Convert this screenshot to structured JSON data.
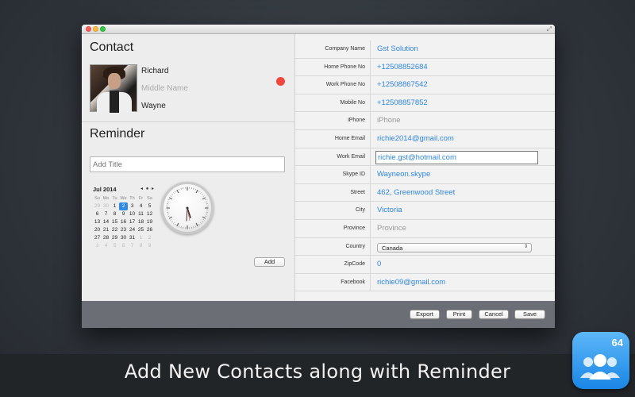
{
  "contact": {
    "title": "Contact",
    "first_name": "Richard",
    "middle_name_placeholder": "Middle Name",
    "last_name": "Wayne"
  },
  "reminder": {
    "title": "Reminder",
    "title_placeholder": "Add Title",
    "add_label": "Add",
    "calendar": {
      "month": "Jul 2014",
      "nav": "◂ ● ▸",
      "weekdays": [
        "Su",
        "Mo",
        "Tu",
        "We",
        "Th",
        "Fr",
        "Sa"
      ],
      "days": [
        [
          "29",
          "30",
          "1",
          "2",
          "3",
          "4",
          "5"
        ],
        [
          "6",
          "7",
          "8",
          "9",
          "10",
          "11",
          "12"
        ],
        [
          "13",
          "14",
          "15",
          "16",
          "17",
          "18",
          "19"
        ],
        [
          "20",
          "21",
          "22",
          "23",
          "24",
          "25",
          "26"
        ],
        [
          "27",
          "28",
          "29",
          "30",
          "31",
          "1",
          "2"
        ],
        [
          "3",
          "4",
          "5",
          "6",
          "7",
          "8",
          "9"
        ]
      ],
      "selected": "2"
    }
  },
  "fields": [
    {
      "label": "Company Name",
      "value": "Gst Solution"
    },
    {
      "label": "Home Phone No",
      "value": "+12508852684"
    },
    {
      "label": "Work Phone No",
      "value": "+12508867542"
    },
    {
      "label": "Mobile No",
      "value": "+12508857852"
    },
    {
      "label": "iPhone",
      "value": "iPhone",
      "placeholder": true
    },
    {
      "label": "Home Email",
      "value": "richie2014@gmail.com"
    },
    {
      "label": "Work Email",
      "value": "richie.gst@hotmail.com",
      "focused": true
    },
    {
      "label": "Skype ID",
      "value": "Wayneon.skype"
    },
    {
      "label": "Street",
      "value": "462, Greenwood Street"
    },
    {
      "label": "City",
      "value": "Victoria"
    },
    {
      "label": "Province",
      "value": "Province",
      "placeholder": true
    },
    {
      "label": "Country",
      "value": "Canada",
      "select": true
    },
    {
      "label": "ZipCode",
      "value": "0"
    },
    {
      "label": "Facebook",
      "value": "richie09@gmail.com"
    }
  ],
  "actions": {
    "export": "Export",
    "print": "Print",
    "cancel": "Cancel",
    "save": "Save"
  },
  "caption": "Add New Contacts along with Reminder",
  "app_icon": {
    "badge": "64",
    "icon": "contacts-group-icon"
  },
  "colors": {
    "link": "#2f86de",
    "accent_red": "#f0473c",
    "selected_day": "#2f8ae5"
  }
}
